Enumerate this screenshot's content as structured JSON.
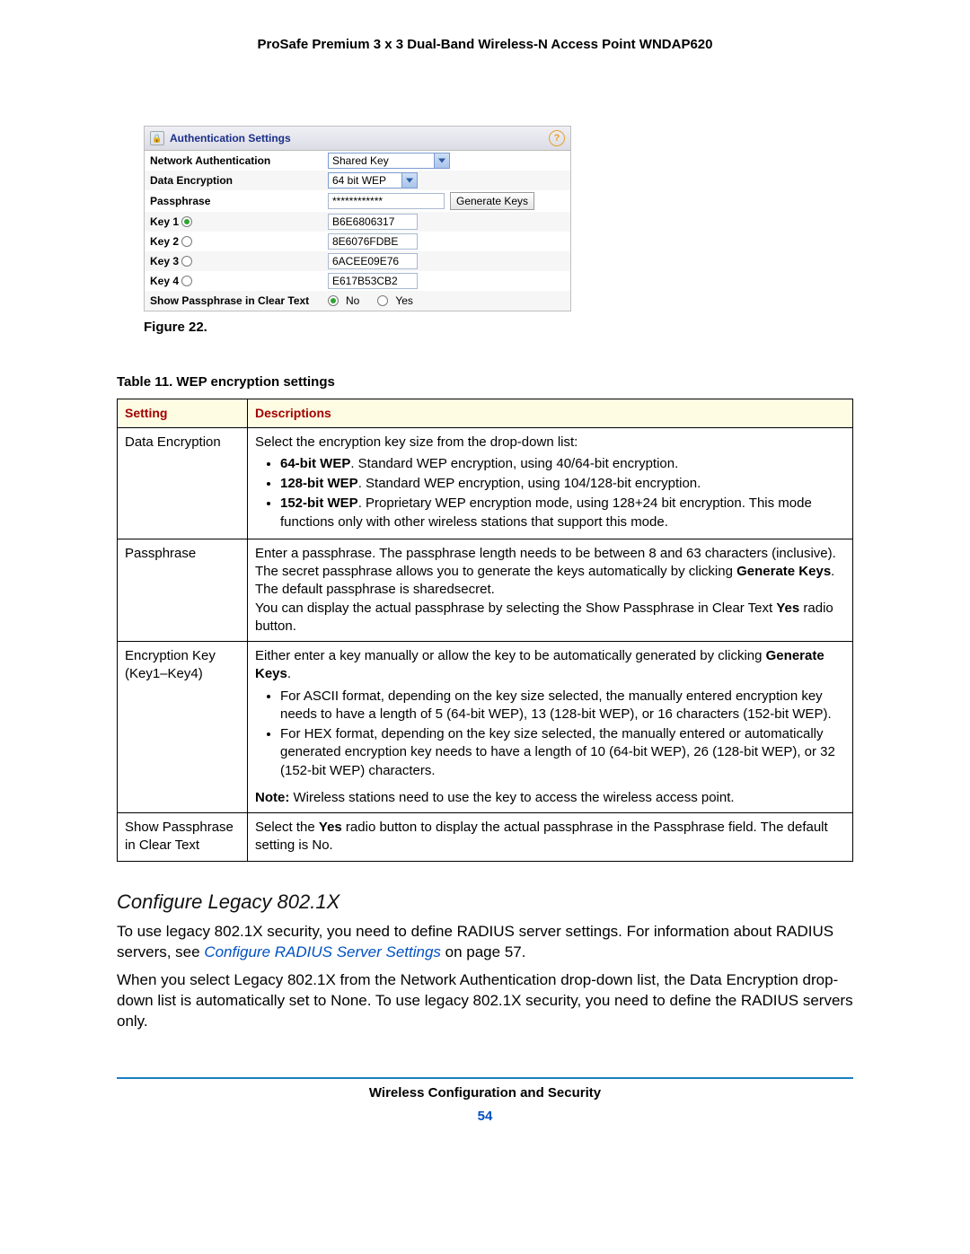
{
  "header": {
    "title": "ProSafe Premium 3 x 3 Dual-Band Wireless-N Access Point WNDAP620"
  },
  "figure": {
    "panel_title": "Authentication Settings",
    "rows": {
      "net_auth_label": "Network Authentication",
      "net_auth_value": "Shared Key",
      "data_enc_label": "Data Encryption",
      "data_enc_value": "64 bit WEP",
      "pass_label": "Passphrase",
      "pass_value": "************",
      "gen_keys_btn": "Generate Keys",
      "key1_label": "Key 1",
      "key1_value": "B6E6806317",
      "key1_checked": true,
      "key2_label": "Key 2",
      "key2_value": "8E6076FDBE",
      "key3_label": "Key 3",
      "key3_value": "6ACEE09E76",
      "key4_label": "Key 4",
      "key4_value": "E617B53CB2",
      "show_pass_label": "Show Passphrase in Clear Text",
      "opt_no": "No",
      "opt_yes": "Yes"
    },
    "caption": "Figure 22."
  },
  "table": {
    "title": "Table 11.  WEP encryption settings",
    "head_setting": "Setting",
    "head_desc": "Descriptions",
    "row1": {
      "setting": "Data Encryption",
      "intro": "Select the encryption key size from the drop-down list:",
      "b1_bold": "64-bit WEP",
      "b1_rest": ". Standard WEP encryption, using 40/64-bit encryption.",
      "b2_bold": "128-bit WEP",
      "b2_rest": ". Standard WEP encryption, using 104/128-bit encryption.",
      "b3_bold": "152-bit WEP",
      "b3_rest": ". Proprietary WEP encryption mode, using 128+24 bit encryption. This mode functions only with other wireless stations that support this mode."
    },
    "row2": {
      "setting": "Passphrase",
      "p1a": "Enter a passphrase. The passphrase length needs to be between 8 and 63 characters (inclusive). The secret passphrase allows you to generate the keys automatically by clicking ",
      "p1_bold": "Generate Keys",
      "p1b": ". The default passphrase is sharedsecret.",
      "p2a": "You can display the actual passphrase by selecting the Show Passphrase in Clear Text ",
      "p2_bold": "Yes",
      "p2b": " radio button."
    },
    "row3": {
      "setting": "Encryption Key (Key1–Key4)",
      "intro_a": "Either enter a key manually or allow the key to be automatically generated by clicking ",
      "intro_bold": "Generate Keys",
      "intro_b": ".",
      "b1": "For ASCII format, depending on the key size selected, the manually entered encryption key needs to have a length of 5 (64-bit WEP), 13 (128-bit WEP), or 16 characters (152-bit WEP).",
      "b2": "For HEX format, depending on the key size selected, the manually entered or automatically generated encryption key needs to have a length of 10 (64-bit WEP), 26 (128-bit WEP), or 32 (152-bit WEP) characters.",
      "note_bold": "Note:",
      "note_rest": "  Wireless stations need to use the key to access the wireless access point."
    },
    "row4": {
      "setting": "Show Passphrase in Clear Text",
      "txt_a": "Select the ",
      "txt_bold": "Yes",
      "txt_b": " radio button to display the actual passphrase in the Passphrase field. The default setting is No."
    }
  },
  "section": {
    "heading": "Configure Legacy 802.1X",
    "p1a": "To use legacy 802.1X security, you need to define RADIUS server settings. For information about RADIUS servers, see ",
    "p1_link": "Configure RADIUS Server Settings",
    "p1b": " on page 57.",
    "p2": "When you select Legacy 802.1X from the Network Authentication drop-down list, the Data Encryption drop-down list is automatically set to None. To use legacy 802.1X security, you need to define the RADIUS servers only."
  },
  "footer": {
    "text": "Wireless Configuration and Security",
    "page": "54"
  }
}
